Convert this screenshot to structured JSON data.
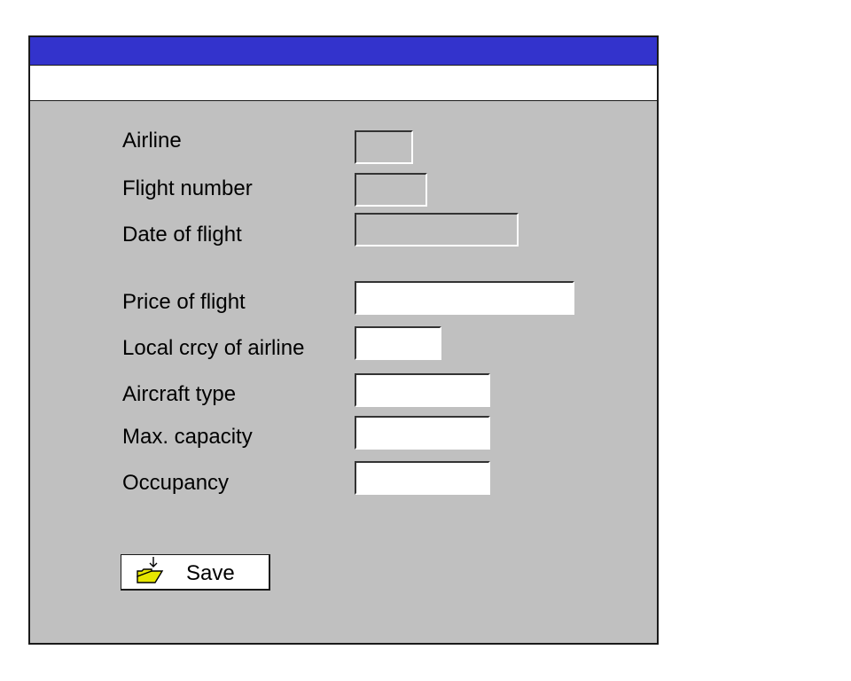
{
  "form": {
    "fields": [
      {
        "label": "Airline",
        "value": ""
      },
      {
        "label": "Flight number",
        "value": ""
      },
      {
        "label": "Date of flight",
        "value": ""
      },
      {
        "label": "Price of flight",
        "value": ""
      },
      {
        "label": "Local crcy of airline",
        "value": ""
      },
      {
        "label": "Aircraft type",
        "value": ""
      },
      {
        "label": "Max. capacity",
        "value": ""
      },
      {
        "label": "Occupancy",
        "value": ""
      }
    ]
  },
  "actions": {
    "save_label": "Save",
    "save_icon": "folder-download-icon"
  },
  "colors": {
    "title_bar": "#3333cc",
    "window_background": "#c0c0c0",
    "icon_folder": "#e6e600"
  }
}
